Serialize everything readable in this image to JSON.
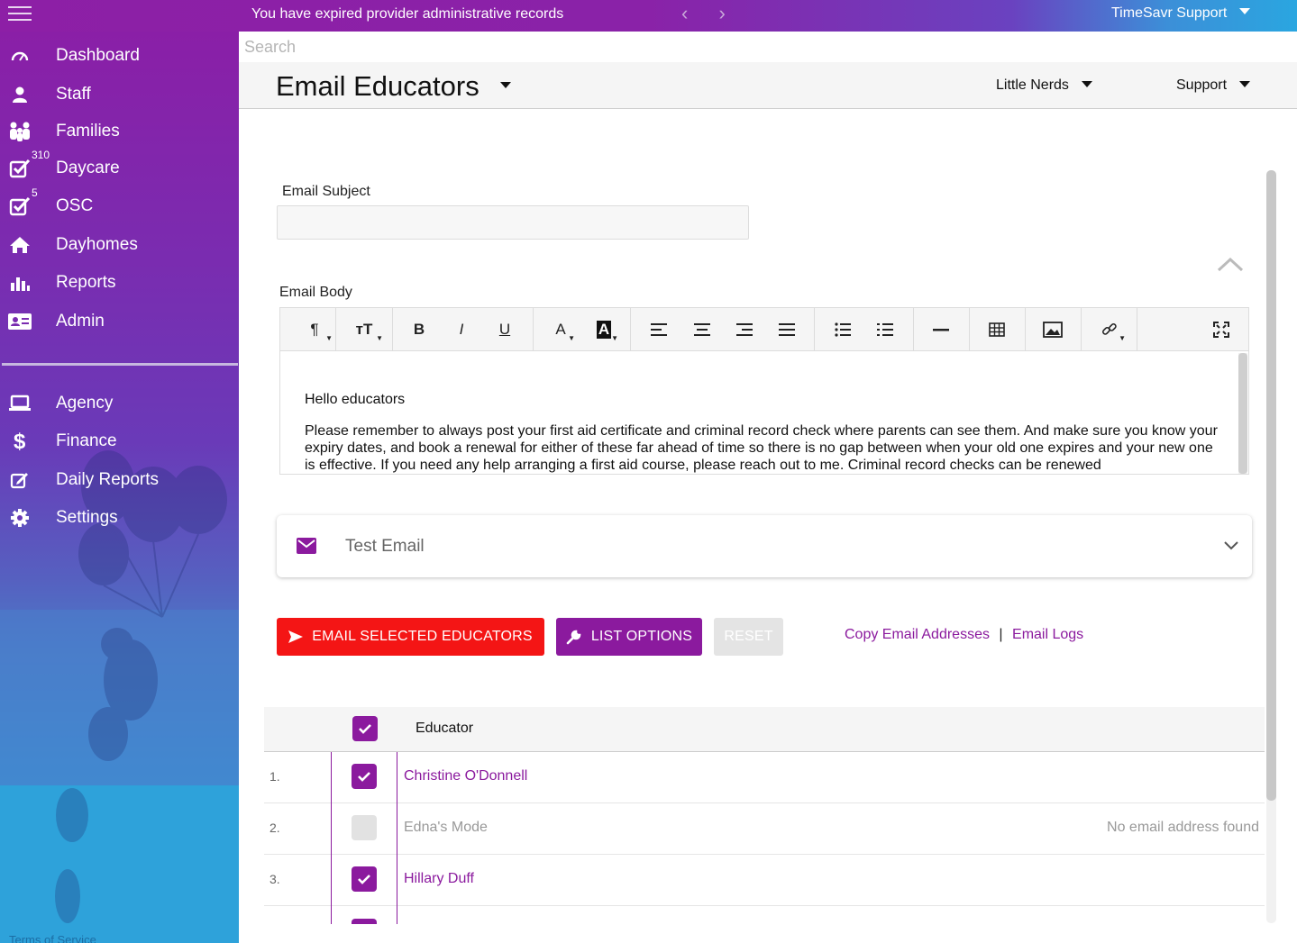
{
  "topbar": {
    "message": "You have expired provider administrative records",
    "nav_arrows": "‹ ›",
    "user_menu": "TimeSavr Support"
  },
  "sidebar": {
    "items": [
      {
        "label": "Dashboard",
        "icon": "speedometer-icon"
      },
      {
        "label": "Staff",
        "icon": "person-icon"
      },
      {
        "label": "Families",
        "icon": "group-icon"
      },
      {
        "label": "Daycare",
        "icon": "checkbox-icon",
        "count": "310"
      },
      {
        "label": "OSC",
        "icon": "checkbox-icon",
        "count": "5"
      },
      {
        "label": "Dayhomes",
        "icon": "home-icon"
      },
      {
        "label": "Reports",
        "icon": "bar-chart-icon"
      },
      {
        "label": "Admin",
        "icon": "id-card-icon"
      }
    ],
    "secondary_items": [
      {
        "label": "Agency",
        "icon": "laptop-icon"
      },
      {
        "label": "Finance",
        "icon": "dollar-icon"
      },
      {
        "label": "Daily Reports",
        "icon": "edit-icon"
      },
      {
        "label": "Settings",
        "icon": "gear-icon"
      }
    ],
    "footer_link": "Terms of Service"
  },
  "search": {
    "placeholder": "Search",
    "value": ""
  },
  "header": {
    "title": "Email Educators",
    "org_dropdown": "Little Nerds",
    "support_dropdown": "Support"
  },
  "form": {
    "subject_label": "Email Subject",
    "subject_value": "",
    "body_label": "Email Body",
    "body_paragraphs": [
      "Hello educators",
      "Please remember to always post your first aid certificate and criminal record check where parents can see them.   And make sure you know your expiry dates, and book a renewal for either of these far ahead of time so there is no gap between when your old one expires and your new one is effective.  If you need any help arranging a first aid course, please reach out to me.  Criminal record checks can be renewed"
    ]
  },
  "editor_toolbar": [
    {
      "name": "paragraph-format",
      "glyph": "¶"
    },
    {
      "name": "font-size",
      "glyph": "тT"
    },
    {
      "name": "bold",
      "glyph": "B"
    },
    {
      "name": "italic",
      "glyph": "I"
    },
    {
      "name": "underline",
      "glyph": "U"
    },
    {
      "name": "text-color",
      "glyph": "A"
    },
    {
      "name": "background-color",
      "glyph": "A"
    },
    {
      "name": "align-left",
      "glyph": ""
    },
    {
      "name": "align-center",
      "glyph": ""
    },
    {
      "name": "align-right",
      "glyph": ""
    },
    {
      "name": "align-justify",
      "glyph": ""
    },
    {
      "name": "unordered-list",
      "glyph": ""
    },
    {
      "name": "ordered-list",
      "glyph": ""
    },
    {
      "name": "horizontal-line",
      "glyph": ""
    },
    {
      "name": "table",
      "glyph": ""
    },
    {
      "name": "image",
      "glyph": ""
    },
    {
      "name": "link",
      "glyph": ""
    },
    {
      "name": "fullscreen",
      "glyph": ""
    }
  ],
  "test_email": {
    "label": "Test Email"
  },
  "actions": {
    "email_selected": "EMAIL SELECTED EDUCATORS",
    "list_options": "LIST OPTIONS",
    "reset": "RESET",
    "copy_emails": "Copy Email Addresses",
    "separator": "|",
    "email_logs": "Email Logs"
  },
  "table": {
    "column_header": "Educator",
    "rows": [
      {
        "num": "1.",
        "name": "Christine O'Donnell",
        "checked": true,
        "note": ""
      },
      {
        "num": "2.",
        "name": "Edna's Mode",
        "checked": false,
        "note": "No email address found"
      },
      {
        "num": "3.",
        "name": "Hillary Duff",
        "checked": true,
        "note": ""
      }
    ]
  },
  "colors": {
    "brand_purple": "#8b1a9e",
    "danger_red": "#f41515",
    "sidebar_top": "#8a1fa7",
    "sidebar_bottom": "#2aa0de"
  }
}
